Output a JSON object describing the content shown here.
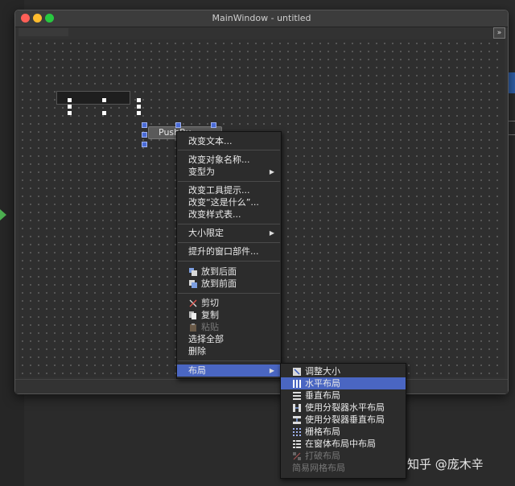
{
  "window": {
    "title": "MainWindow - untitled",
    "expand_button": "»"
  },
  "form": {
    "push_button_label": "PushBu..."
  },
  "context_menu": {
    "items": [
      {
        "label": "改变文本...",
        "icon": null,
        "submenu": false
      },
      {
        "label": "改变对象名称...",
        "icon": null,
        "submenu": false
      },
      {
        "label": "变型为",
        "icon": null,
        "submenu": true
      },
      {
        "label": "改变工具提示...",
        "icon": null,
        "submenu": false
      },
      {
        "label": "改变“这是什么”...",
        "icon": null,
        "submenu": false
      },
      {
        "label": "改变样式表...",
        "icon": null,
        "submenu": false
      },
      {
        "label": "大小限定",
        "icon": null,
        "submenu": true
      },
      {
        "label": "提升的窗口部件...",
        "icon": null,
        "submenu": false
      },
      {
        "label": "放到后面",
        "icon": "send-to-back-icon",
        "submenu": false
      },
      {
        "label": "放到前面",
        "icon": "bring-to-front-icon",
        "submenu": false
      },
      {
        "label": "剪切",
        "icon": "scissors-icon",
        "submenu": false
      },
      {
        "label": "复制",
        "icon": "copy-icon",
        "submenu": false
      },
      {
        "label": "粘贴",
        "icon": "paste-icon",
        "submenu": false,
        "disabled": true
      },
      {
        "label": "选择全部",
        "icon": null,
        "submenu": false
      },
      {
        "label": "删除",
        "icon": null,
        "submenu": false
      },
      {
        "label": "布局",
        "icon": null,
        "submenu": true,
        "highlighted": true
      }
    ]
  },
  "layout_submenu": {
    "items": [
      {
        "label": "调整大小",
        "icon": "adjust-size-icon"
      },
      {
        "label": "水平布局",
        "icon": "horizontal-layout-icon",
        "highlighted": true
      },
      {
        "label": "垂直布局",
        "icon": "vertical-layout-icon"
      },
      {
        "label": "使用分裂器水平布局",
        "icon": "horizontal-splitter-icon"
      },
      {
        "label": "使用分裂器垂直布局",
        "icon": "vertical-splitter-icon"
      },
      {
        "label": "栅格布局",
        "icon": "grid-layout-icon"
      },
      {
        "label": "在窗体布局中布局",
        "icon": "form-layout-icon"
      },
      {
        "label": "打破布局",
        "icon": "break-layout-icon",
        "disabled": true
      },
      {
        "label": "简易网格布局",
        "icon": null,
        "disabled": true
      }
    ]
  },
  "watermark": "知乎 @庞木辛",
  "colors": {
    "highlight": "#4a66c2",
    "background": "#2b2b2b",
    "menu": "#2c2c2c"
  }
}
